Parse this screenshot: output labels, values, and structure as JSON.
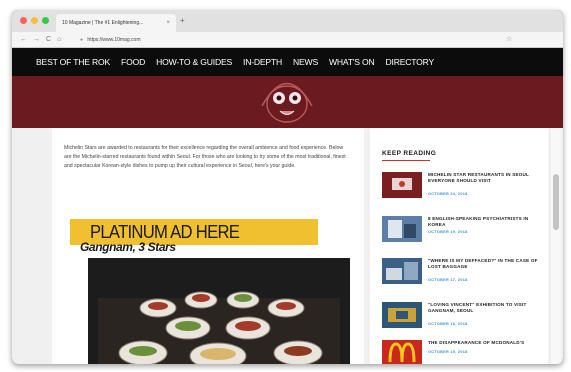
{
  "browser": {
    "tab_title": "10 Magazine | The #1 Enlightening...",
    "tab_close": "×",
    "new_tab": "+",
    "url": "https://www.10mag.com",
    "nav_back": "←",
    "nav_forward": "→",
    "nav_reload": "C",
    "nav_home": "⌂",
    "lock": "🔒",
    "bookmark": "☆",
    "dot_colors": [
      "#fc605c",
      "#fdbc40",
      "#34c84a"
    ]
  },
  "site_nav": {
    "items": [
      "BEST OF THE ROK",
      "FOOD",
      "HOW-TO & GUIDES",
      "IN-DEPTH",
      "NEWS",
      "WHAT'S ON",
      "DIRECTORY"
    ]
  },
  "hero": {
    "color": "#6b1a1f"
  },
  "article": {
    "intro": "Michelin Stars are awarded to restaurants for their excellence regarding the overall ambience and food experience. Below are the Michelin-starred restaurants found within Seoul. For those who are looking to try some of the most traditional, finest and spectacular Korean-style dishes to pump up their cultural experience in Seoul, here's your guide.",
    "ad_text": "PLATINUM AD HERE",
    "ad_color": "#f0c030",
    "subhead": "Gangnam, 3 Stars"
  },
  "sidebar": {
    "title": "KEEP READING",
    "accent": "#c0392b",
    "date_color": "#3a8fd0",
    "cards": [
      {
        "title": "MICHELIN STAR RESTAURANTS IN SEOUL EVERYONE SHOULD VISIT",
        "date": "OCTOBER 24, 2018"
      },
      {
        "title": "8 ENGLISH-SPEAKING PSYCHIATRISTS IN KOREA",
        "date": "OCTOBER 19, 2018"
      },
      {
        "title": "\"WHERE IS MY DEFFACED?\" IN THE CASE OF LOST BAGGAGE",
        "date": "OCTOBER 17, 2018"
      },
      {
        "title": "\"LOVING VINCENT\" EXHIBITION TO VISIT GANGNAM, SEOUL",
        "date": "OCTOBER 16, 2018"
      },
      {
        "title": "THE DISAPPEARANCE OF MCDONALD'S",
        "date": "OCTOBER 15, 2018"
      }
    ]
  }
}
